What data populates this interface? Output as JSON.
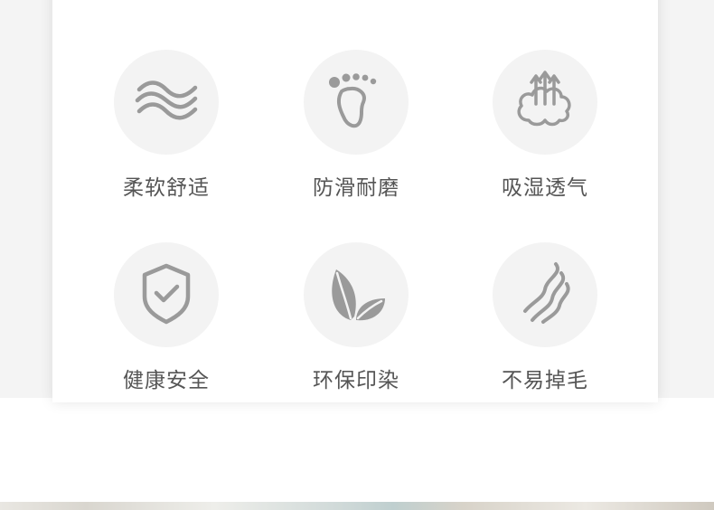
{
  "features": [
    {
      "label": "柔软舒适",
      "icon": "waves-icon"
    },
    {
      "label": "防滑耐磨",
      "icon": "footprint-icon"
    },
    {
      "label": "吸湿透气",
      "icon": "cloud-arrows-icon"
    },
    {
      "label": "健康安全",
      "icon": "shield-check-icon"
    },
    {
      "label": "环保印染",
      "icon": "leaves-icon"
    },
    {
      "label": "不易掉毛",
      "icon": "fibers-icon"
    }
  ],
  "colors": {
    "icon": "#9a9a9a",
    "circle": "#f3f3f3",
    "text": "#555555"
  }
}
